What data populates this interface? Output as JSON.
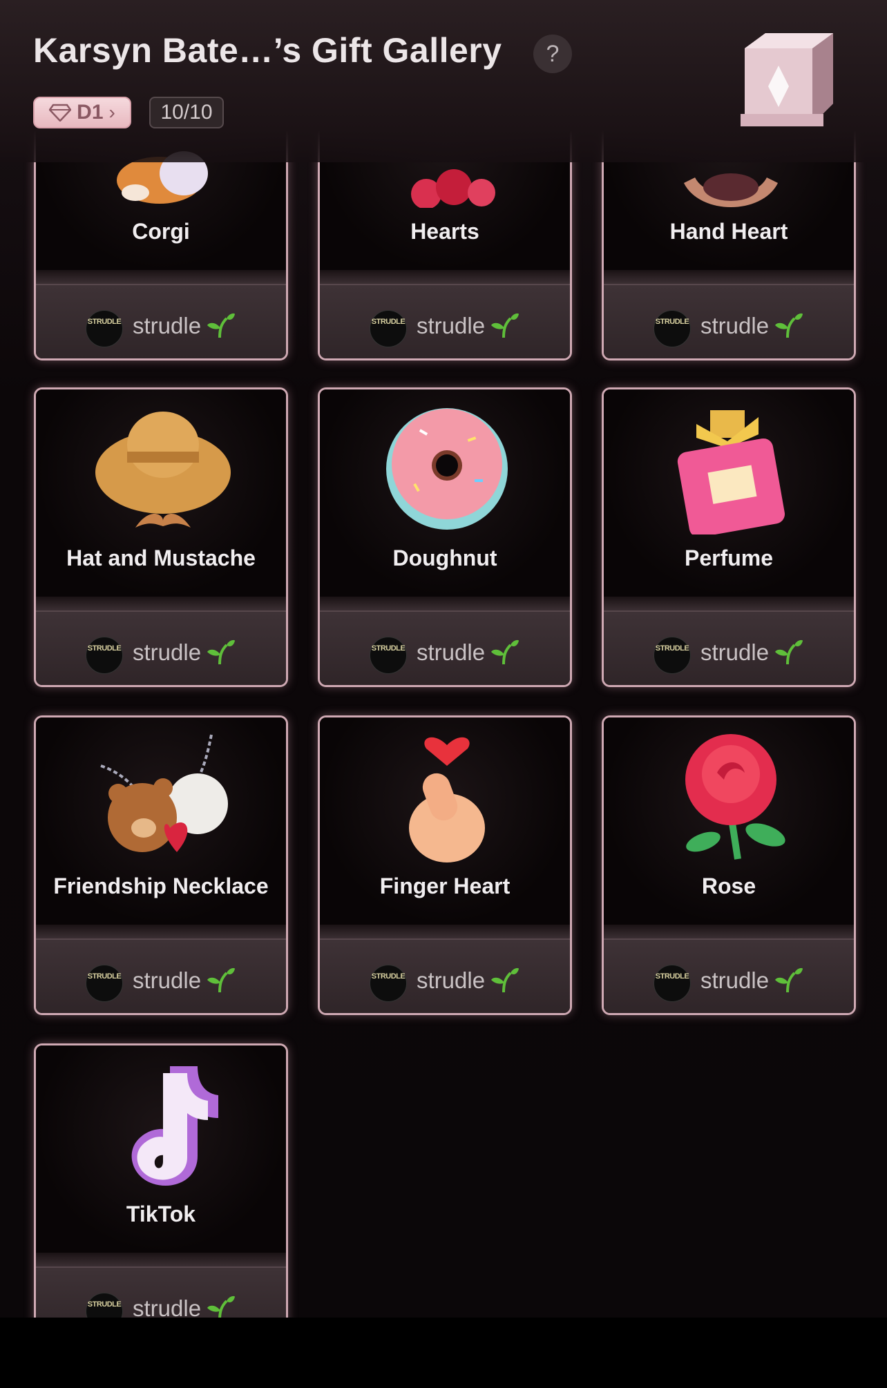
{
  "header": {
    "title": "Karsyn Bate…’s Gift Gallery",
    "help_label": "?",
    "level_badge": "D1",
    "level_chevron": "›",
    "count": "10/10"
  },
  "gifts": [
    {
      "name": "Corgi",
      "icon": "corgi-icon",
      "sender": "strudle",
      "avatar_text": "STRUDLE"
    },
    {
      "name": "Hearts",
      "icon": "hearts-icon",
      "sender": "strudle",
      "avatar_text": "STRUDLE"
    },
    {
      "name": "Hand Heart",
      "icon": "hand-heart-icon",
      "sender": "strudle",
      "avatar_text": "STRUDLE"
    },
    {
      "name": "Hat and Mustache",
      "icon": "hat-mustache-icon",
      "sender": "strudle",
      "avatar_text": "STRUDLE"
    },
    {
      "name": "Doughnut",
      "icon": "doughnut-icon",
      "sender": "strudle",
      "avatar_text": "STRUDLE"
    },
    {
      "name": "Perfume",
      "icon": "perfume-icon",
      "sender": "strudle",
      "avatar_text": "STRUDLE"
    },
    {
      "name": "Friendship Necklace",
      "icon": "bears-necklace-icon",
      "sender": "strudle",
      "avatar_text": "STRUDLE"
    },
    {
      "name": "Finger Heart",
      "icon": "finger-heart-icon",
      "sender": "strudle",
      "avatar_text": "STRUDLE"
    },
    {
      "name": "Rose",
      "icon": "rose-icon",
      "sender": "strudle",
      "avatar_text": "STRUDLE"
    },
    {
      "name": "TikTok",
      "icon": "tiktok-icon",
      "sender": "strudle",
      "avatar_text": "STRUDLE"
    }
  ],
  "colors": {
    "card_border": "#cfa9b3",
    "badge_pink": "#f5d9dd",
    "sprout_green": "#5fbf3a"
  }
}
